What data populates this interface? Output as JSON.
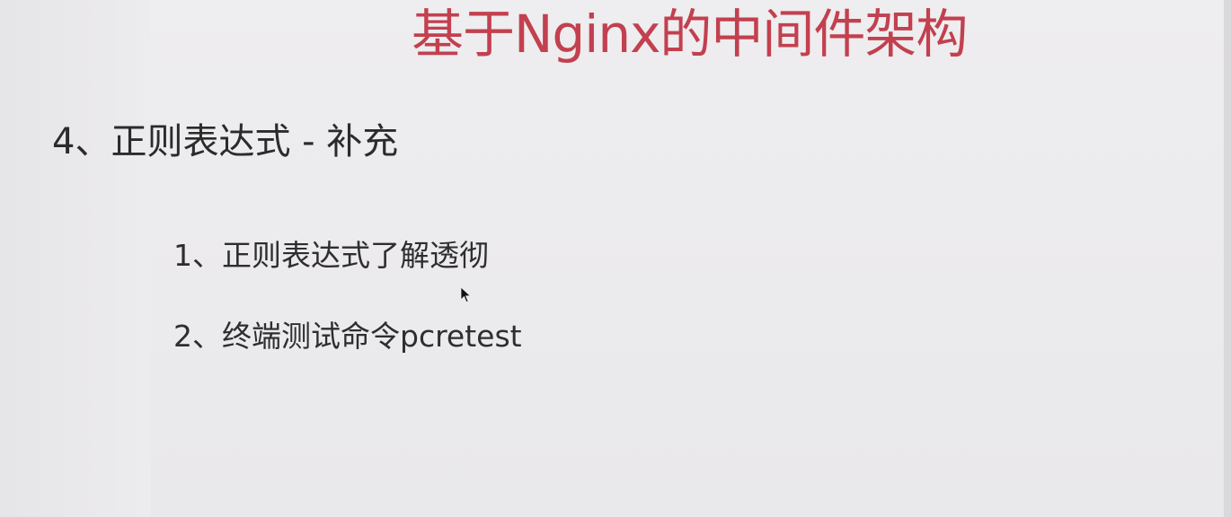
{
  "slide": {
    "title": "基于Nginx的中间件架构",
    "heading": "4、正则表达式 - 补充",
    "items": [
      {
        "label": "1、正则表达式了解透彻"
      },
      {
        "label": "2、终端测试命令pcretest"
      }
    ]
  },
  "colors": {
    "title": "#c2404f",
    "text": "#2b2b2b",
    "background": "#ecebed"
  },
  "icons": {
    "cursor": "mouse-pointer-icon"
  }
}
